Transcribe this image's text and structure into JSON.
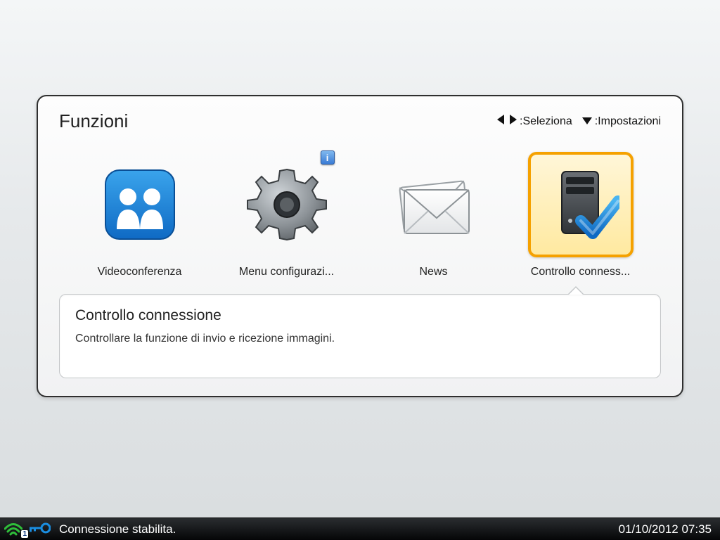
{
  "panel": {
    "title": "Funzioni",
    "hint_select": ":Seleziona",
    "hint_settings": ":Impostazioni"
  },
  "functions": {
    "videoconf": {
      "label": "Videoconferenza"
    },
    "config": {
      "label": "Menu configurazi...",
      "info_badge": "i"
    },
    "news": {
      "label": "News"
    },
    "conncheck": {
      "label": "Controllo conness..."
    }
  },
  "description": {
    "title": "Controllo connessione",
    "text": "Controllare la funzione di invio e ricezione immagini."
  },
  "status": {
    "wifi_level_badge": "1",
    "text": "Connessione stabilita.",
    "datetime": "01/10/2012 07:35"
  }
}
